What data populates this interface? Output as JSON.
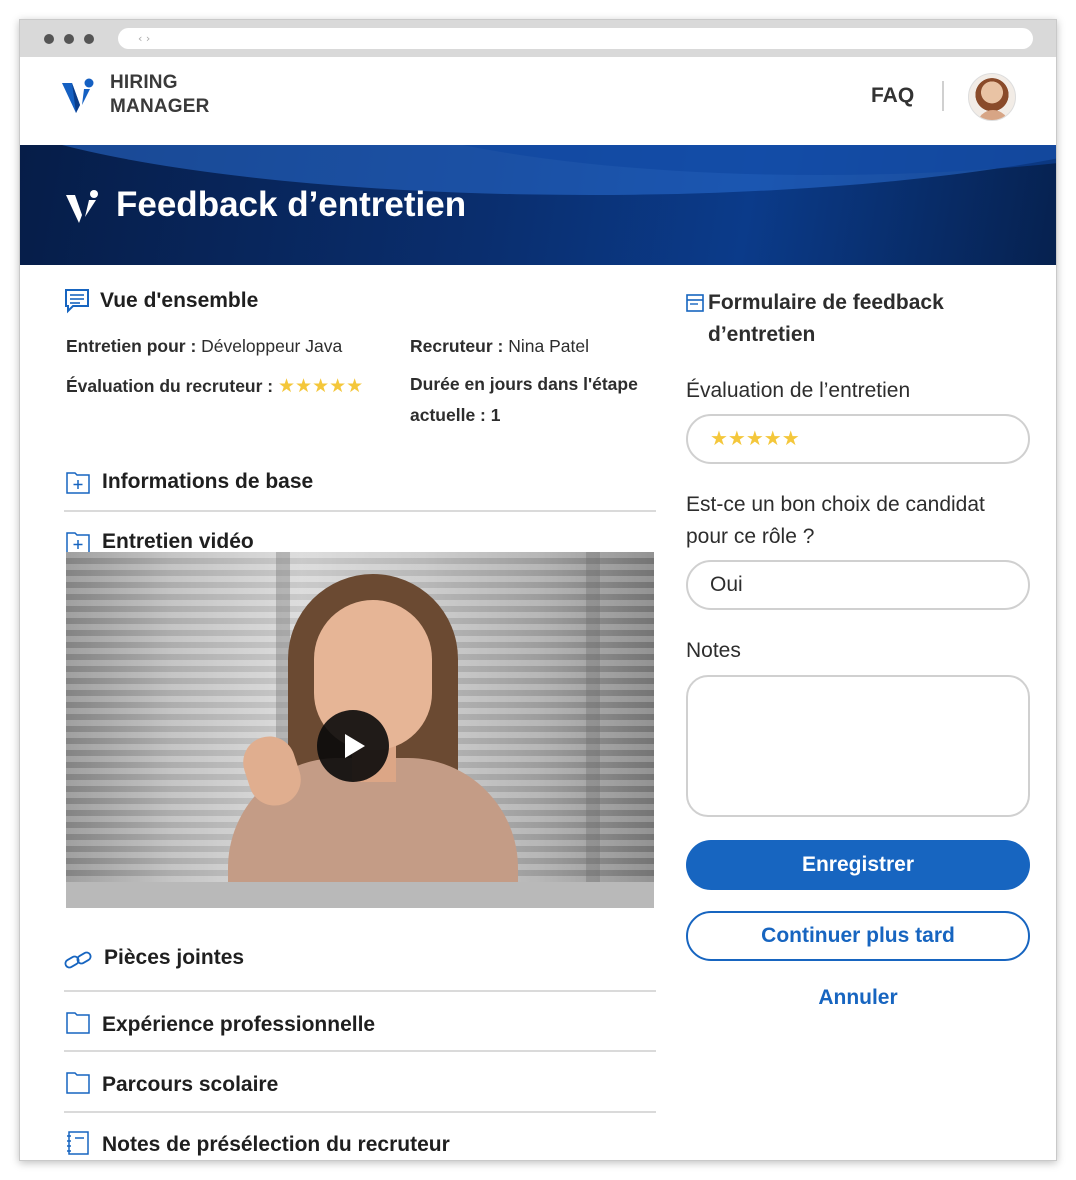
{
  "browser": {
    "url_glyph": "‹ ›"
  },
  "header": {
    "brand_line1": "HIRING",
    "brand_line2": "MANAGER",
    "faq": "FAQ"
  },
  "banner": {
    "title": "Feedback d’entretien"
  },
  "overview": {
    "title": "Vue d'ensemble",
    "interview_label": "Entretien pour :",
    "interview_value": "Développeur Java",
    "recruiter_label": "Recruteur :",
    "recruiter_value": "Nina Patel",
    "rating_label": "Évaluation du recruteur :",
    "rating_stars": "★★★★★",
    "rating_value": 5,
    "duration_label_line1": "Durée en jours dans l'étape",
    "duration_label_line2": "actuelle : 1"
  },
  "sections": {
    "basic_info": "Informations de base",
    "video_interview": "Entretien vidéo",
    "attachments": "Pièces jointes",
    "experience": "Expérience professionnelle",
    "education": "Parcours scolaire",
    "recruiter_notes": "Notes de présélection du recruteur"
  },
  "form": {
    "title_line1": "Formulaire de feedback",
    "title_line2": "d’entretien",
    "rating_label": "Évaluation de l’entretien",
    "rating_stars": "★★★★★",
    "rating_value": 5,
    "fit_label_line1": "Est-ce un bon choix de candidat",
    "fit_label_line2": "pour ce rôle ?",
    "fit_value": "Oui",
    "notes_label": "Notes",
    "notes_value": "",
    "save_button": "Enregistrer",
    "continue_button": "Continuer plus tard",
    "cancel_link": "Annuler"
  },
  "colors": {
    "primary": "#1765c0",
    "banner_dark": "#061d48",
    "star": "#f4c73b"
  }
}
